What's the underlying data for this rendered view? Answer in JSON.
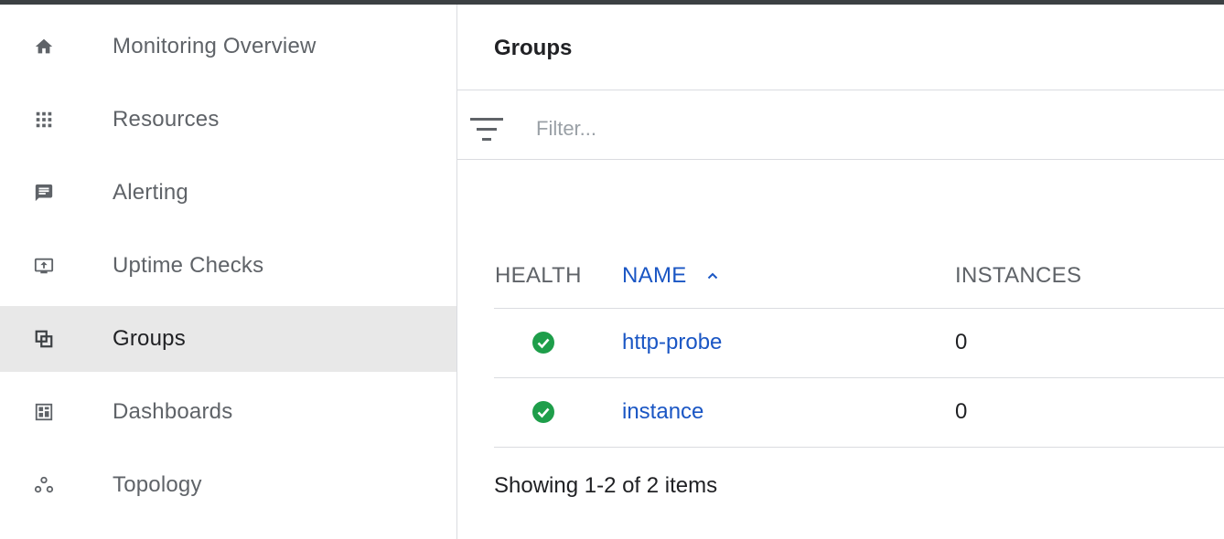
{
  "sidebar": {
    "items": [
      {
        "label": "Monitoring Overview",
        "icon": "home-icon"
      },
      {
        "label": "Resources",
        "icon": "apps-grid-icon"
      },
      {
        "label": "Alerting",
        "icon": "alert-message-icon"
      },
      {
        "label": "Uptime Checks",
        "icon": "monitor-upload-icon"
      },
      {
        "label": "Groups",
        "icon": "groups-icon",
        "active": true
      },
      {
        "label": "Dashboards",
        "icon": "dashboard-icon"
      },
      {
        "label": "Topology",
        "icon": "topology-icon"
      }
    ]
  },
  "main": {
    "title": "Groups",
    "filter": {
      "placeholder": "Filter...",
      "value": "",
      "icon": "filter-icon"
    },
    "table": {
      "columns": {
        "health": "HEALTH",
        "name": "NAME",
        "instances": "INSTANCES"
      },
      "sort": {
        "column": "name",
        "direction": "ascending",
        "icon": "sort-ascending-icon"
      },
      "rows": [
        {
          "health": "healthy",
          "name": "http-probe",
          "instances": "0"
        },
        {
          "health": "healthy",
          "name": "instance",
          "instances": "0"
        }
      ]
    },
    "footer": "Showing 1-2 of 2 items"
  },
  "colors": {
    "link": "#1a56c4",
    "healthy": "#1e9e4a",
    "active_bg": "#e8e8e8",
    "divider": "#dadce0",
    "muted_text": "#5f6368"
  }
}
